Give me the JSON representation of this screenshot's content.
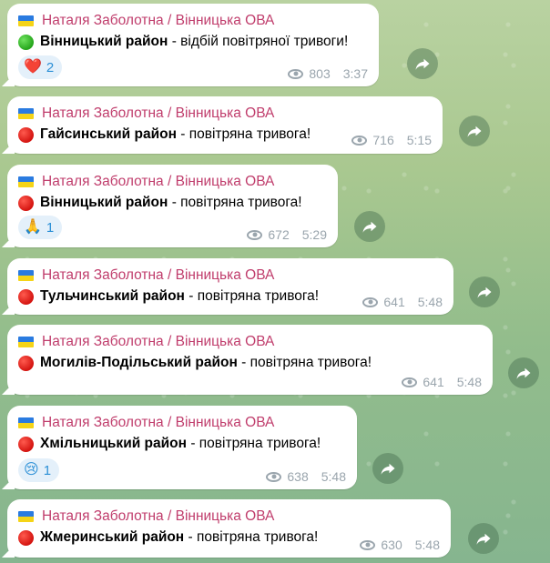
{
  "messages": [
    {
      "sender": "Наталя Заболотна / Вінницька ОВА",
      "status": "green",
      "region": "Вінницький район",
      "status_text": " - відбій повітряної тривоги!",
      "reaction": {
        "emoji": "❤️",
        "count": "2"
      },
      "views": "803",
      "time": "3:37"
    },
    {
      "sender": "Наталя Заболотна / Вінницька ОВА",
      "status": "red",
      "region": "Гайсинський район",
      "status_text": " - повітряна тривога!",
      "reaction": null,
      "views": "716",
      "time": "5:15"
    },
    {
      "sender": "Наталя Заболотна / Вінницька ОВА",
      "status": "red",
      "region": "Вінницький район",
      "status_text": " - повітряна тривога!",
      "reaction": {
        "emoji": "🙏",
        "count": "1"
      },
      "views": "672",
      "time": "5:29"
    },
    {
      "sender": "Наталя Заболотна / Вінницька ОВА",
      "status": "red",
      "region": "Тульчинський район",
      "status_text": " - повітряна тривога!",
      "reaction": null,
      "views": "641",
      "time": "5:48"
    },
    {
      "sender": "Наталя Заболотна / Вінницька ОВА",
      "status": "red",
      "region": "Могилів-Подільський район",
      "status_text": " - повітряна тривога!",
      "reaction": null,
      "views": "641",
      "time": "5:48"
    },
    {
      "sender": "Наталя Заболотна / Вінницька ОВА",
      "status": "red",
      "region": "Хмільницький район",
      "status_text": " - повітряна тривога!",
      "reaction": {
        "emoji": "😢",
        "count": "1"
      },
      "views": "638",
      "time": "5:48"
    },
    {
      "sender": "Наталя Заболотна / Вінницька ОВА",
      "status": "red",
      "region": "Жмеринський район",
      "status_text": " - повітряна тривога!",
      "reaction": null,
      "views": "630",
      "time": "5:48"
    }
  ],
  "icons": {
    "flag": "ukraine-flag-icon",
    "status_green": "green-circle-icon",
    "status_red": "red-circle-icon",
    "views": "eye-icon",
    "forward": "forward-share-icon"
  },
  "colors": {
    "sender": "#c03d6c",
    "meta": "#9aa5ad",
    "reaction_text": "#2b8fd6",
    "reaction_bg": "#e4f0fa",
    "bubble": "#ffffff"
  }
}
